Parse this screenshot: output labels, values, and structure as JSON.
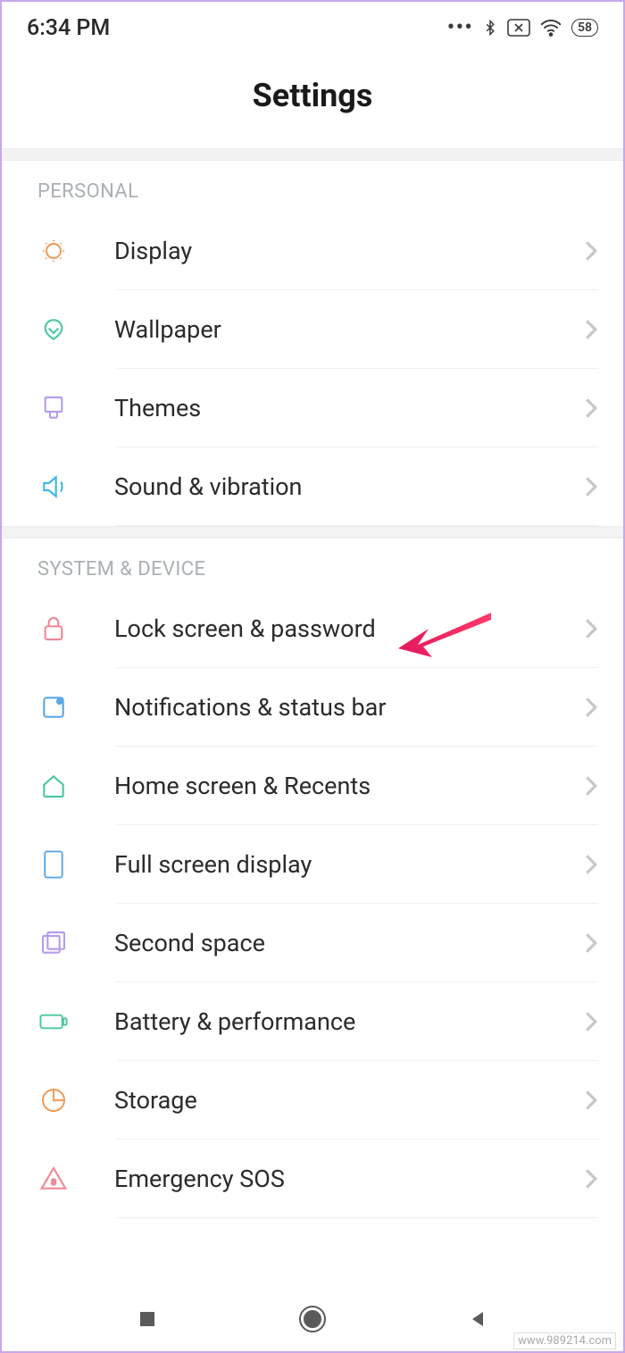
{
  "status": {
    "time": "6:34 PM",
    "battery": "58"
  },
  "header": {
    "title": "Settings"
  },
  "sections": {
    "personal": {
      "label": "PERSONAL",
      "items": {
        "display": "Display",
        "wallpaper": "Wallpaper",
        "themes": "Themes",
        "sound": "Sound & vibration"
      }
    },
    "system": {
      "label": "SYSTEM & DEVICE",
      "items": {
        "lock": "Lock screen & password",
        "notifications": "Notifications & status bar",
        "home": "Home screen & Recents",
        "fullscreen": "Full screen display",
        "secondspace": "Second space",
        "battery": "Battery & performance",
        "storage": "Storage",
        "sos": "Emergency SOS"
      }
    }
  },
  "watermark": "www.989214.com"
}
